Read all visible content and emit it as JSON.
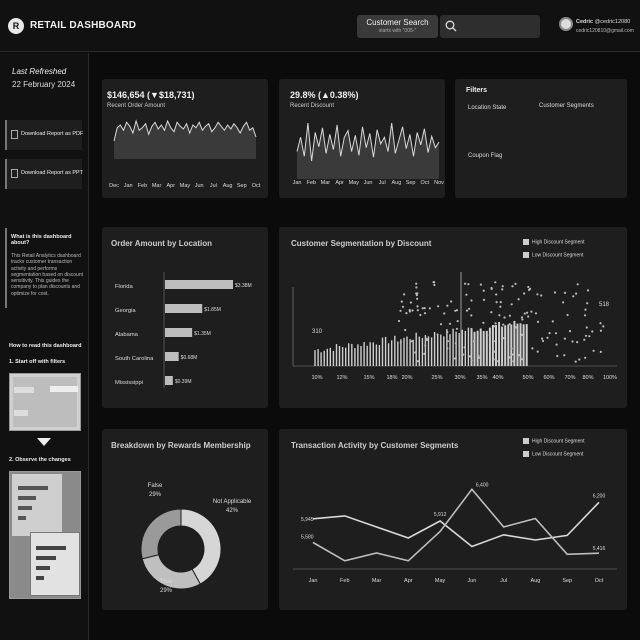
{
  "header": {
    "logo_letter": "R",
    "title": "RETAIL DASHBOARD",
    "search_chip_title": "Customer Search",
    "search_chip_hint": "starts with \"005-\"",
    "user_name": "Cedric",
    "user_handle": "@cedric12080",
    "user_email": "cedric120810@gmail.com"
  },
  "sidebar": {
    "refresh_label": "Last Refreshed",
    "refresh_date": "22 February 2024",
    "download_pdf": "Download Report as PDF",
    "download_ppt": "Download Report as PPT",
    "about_title": "What is this dashboard about?",
    "about_text": "This Retail Analytics dashboard tracks customer transaction activity and performs segmentation based on discount sensitivity. This guides the company to plan discounts and optimize for cost.",
    "howto_title": "How to read this dashboard",
    "step1": "1.  Start off with filters",
    "step2": "2.  Observe the changes"
  },
  "kpi_amount": {
    "value": "$146,654 (▼$18,731)",
    "label": "Recent Order Amount",
    "months": [
      "Dec",
      "Jan",
      "Feb",
      "Mar",
      "Apr",
      "May",
      "Jun",
      "Jul",
      "Aug",
      "Sep",
      "Oct"
    ],
    "series": [
      52,
      62,
      64,
      60,
      66,
      63,
      58,
      67,
      60,
      62,
      65,
      57,
      63,
      66,
      61,
      64,
      60,
      67,
      62,
      59,
      66,
      63,
      61,
      65,
      58,
      64,
      62,
      66,
      60,
      63,
      65,
      59,
      62,
      66,
      63,
      60,
      64,
      61,
      65,
      62,
      58,
      63,
      66,
      60,
      62,
      55
    ]
  },
  "kpi_discount": {
    "value": "29.8% (▲0.38%)",
    "label": "Recent Discount",
    "months": [
      "Jan",
      "Feb",
      "Mar",
      "Apr",
      "May",
      "Jun",
      "Jul",
      "Aug",
      "Sep",
      "Oct",
      "Nov"
    ],
    "series": [
      40,
      55,
      35,
      70,
      30,
      60,
      45,
      65,
      38,
      58,
      42,
      68,
      35,
      55,
      62,
      40,
      57,
      36,
      66,
      44,
      59,
      34,
      63,
      48,
      55,
      40,
      70,
      38,
      52,
      66,
      43,
      58,
      35,
      60,
      47,
      64,
      39,
      56,
      44,
      50
    ]
  },
  "filters": {
    "title": "Filters",
    "location_state": "Location State",
    "customer_segments": "Customer Segments",
    "coupon_flag": "Coupon Flag"
  },
  "location_chart": {
    "title": "Order Amount by Location",
    "chart_data": {
      "type": "bar",
      "categories": [
        "Florida",
        "Georgia",
        "Alabama",
        "South Carolina",
        "Mississippi"
      ],
      "values": [
        3.38,
        1.85,
        1.35,
        0.68,
        0.39
      ],
      "value_labels": [
        "$3.38M",
        "$1.85M",
        "$1.35M",
        "$0.68M",
        "$0.39M"
      ]
    }
  },
  "segmentation_chart": {
    "title": "Customer Segmentation by Discount",
    "legend": [
      "High Discount Segment",
      "Low Discount Segment"
    ],
    "x_ticks": [
      "10%",
      "12%",
      "15%",
      "18%",
      "20%",
      "25%",
      "30%",
      "35%",
      "40%",
      "50%",
      "60%",
      "70%",
      "80%",
      "100%"
    ],
    "annotations": [
      "518",
      "310"
    ]
  },
  "rewards_chart": {
    "title": "Breakdown by Rewards Membership",
    "chart_data": {
      "type": "pie",
      "labels": [
        "False",
        "Not Applicable",
        "True"
      ],
      "values": [
        29,
        42,
        29
      ],
      "value_labels": [
        "29%",
        "42%",
        "29%"
      ]
    }
  },
  "transaction_chart": {
    "title": "Transaction Activity by Customer Segments",
    "legend": [
      "High Discount Segment",
      "Low Discount Segment"
    ],
    "chart_data": {
      "type": "line",
      "categories": [
        "Jan",
        "Feb",
        "Mar",
        "Apr",
        "May",
        "Jun",
        "Jul",
        "Aug",
        "Sep",
        "Oct"
      ],
      "series": [
        {
          "name": "High Discount Segment",
          "values": [
            5945,
            5990,
            5820,
            5650,
            5912,
            5520,
            5700,
            5620,
            5690,
            6200
          ]
        },
        {
          "name": "Low Discount Segment",
          "values": [
            5580,
            5300,
            5420,
            5300,
            5750,
            6400,
            5820,
            5950,
            5400,
            5416
          ]
        }
      ],
      "point_labels": {
        "Jan": "5,945",
        "Jan2": "5,580",
        "May": "5,912",
        "Jun": "6,400",
        "Oct": "6,200",
        "Oct2": "5,416"
      }
    }
  }
}
